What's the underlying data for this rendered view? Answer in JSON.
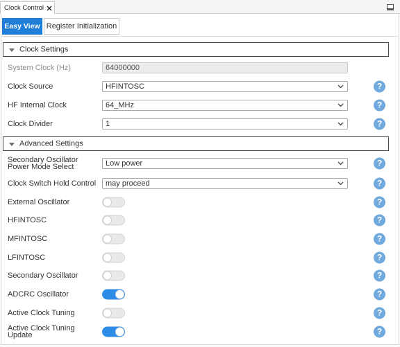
{
  "window": {
    "tab_title": "Clock Control"
  },
  "view_tabs": {
    "items": [
      {
        "label": "Easy View",
        "selected": true
      },
      {
        "label": "Register Initialization",
        "selected": false
      }
    ]
  },
  "clock_settings": {
    "header": "Clock Settings",
    "expanded": true,
    "system_clock": {
      "label": "System Clock (Hz)",
      "value": "64000000",
      "disabled": true
    },
    "clock_source": {
      "label": "Clock Source",
      "value": "HFINTOSC"
    },
    "hf_internal_clock": {
      "label": "HF Internal Clock",
      "value": "64_MHz"
    },
    "clock_divider": {
      "label": "Clock Divider",
      "value": "1"
    }
  },
  "advanced_settings": {
    "header": "Advanced Settings",
    "expanded": true,
    "secondary_oscillator_power_mode": {
      "label": "Secondary Oscillator Power Mode Select",
      "value": "Low power"
    },
    "clock_switch_hold_control": {
      "label": "Clock Switch Hold Control",
      "value": "may proceed"
    },
    "external_oscillator": {
      "label": "External Oscillator",
      "enabled": false
    },
    "hfintosc": {
      "label": "HFINTOSC",
      "enabled": false
    },
    "mfintosc": {
      "label": "MFINTOSC",
      "enabled": false
    },
    "lfintosc": {
      "label": "LFINTOSC",
      "enabled": false
    },
    "secondary_oscillator": {
      "label": "Secondary Oscillator",
      "enabled": false
    },
    "adcrc_oscillator": {
      "label": "ADCRC Oscillator",
      "enabled": true
    },
    "active_clock_tuning": {
      "label": "Active Clock Tuning",
      "enabled": false
    },
    "active_clock_tuning_update": {
      "label": "Active Clock Tuning Update",
      "enabled": true
    }
  },
  "help_icon": {
    "glyph": "?"
  },
  "icons": {
    "tab_close": "close-icon",
    "panel_minimize": "minimize-icon",
    "section_expander": "caret-down-icon",
    "select_arrow": "chevron-down-icon",
    "help": "help-icon"
  },
  "colors": {
    "accent": "#1f7fd8",
    "toggle_on": "#2d8ce6",
    "toggle_off": "#e9e9e9",
    "help": "#6fa9dd",
    "section_border": "#4a4a4a",
    "disabled_field": "#ececec"
  }
}
